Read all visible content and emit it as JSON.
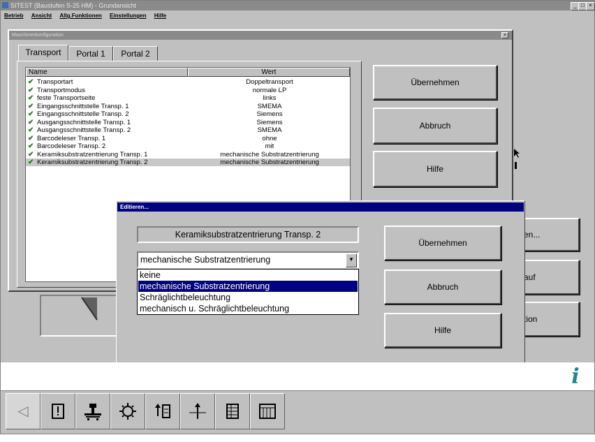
{
  "window": {
    "title": "SITEST (Baustufen S-25 HM) - Grundansicht",
    "menu": [
      "Betrieb",
      "Ansicht",
      "Allg.Funktionen",
      "Einstellungen",
      "Hilfe"
    ],
    "controls": [
      "_",
      "□",
      "×"
    ]
  },
  "machine_dialog": {
    "title": "Maschinenkonfiguration",
    "close": "×",
    "tabs": [
      "Transport",
      "Portal 1",
      "Portal 2"
    ],
    "columns": {
      "name": "Name",
      "value": "Wert"
    },
    "rows": [
      {
        "name": "Transportart",
        "value": "Doppeltransport"
      },
      {
        "name": "Transportmodus",
        "value": "normale LP"
      },
      {
        "name": "feste Transportseite",
        "value": "links"
      },
      {
        "name": "Eingangsschnittstelle Transp. 1",
        "value": "SMEMA"
      },
      {
        "name": "Eingangsschnittstelle Transp. 2",
        "value": "Siemens"
      },
      {
        "name": "Ausgangsschnittstelle Transp. 1",
        "value": "Siemens"
      },
      {
        "name": "Ausgangsschnittstelle Transp. 2",
        "value": "SMEMA"
      },
      {
        "name": "Barcodeleser Transp. 1",
        "value": "ohne"
      },
      {
        "name": "Barcodeleser Transp. 2",
        "value": "mit"
      },
      {
        "name": "Keramiksubstratzentrierung Transp. 1",
        "value": "mechanische Substratzentrierung"
      },
      {
        "name": "Keramiksubstratzentrierung Transp. 2",
        "value": "mechanische Substratzentrierung",
        "selected": true
      }
    ],
    "buttons": {
      "apply": "Übernehmen",
      "cancel": "Abbruch",
      "help": "Hilfe"
    }
  },
  "side_buttons": [
    "en...",
    "auf",
    "tion"
  ],
  "edit_dialog": {
    "title": "Editieren...",
    "field_label": "Keramiksubstratzentrierung Transp. 2",
    "combo_value": "mechanische Substratzentrierung",
    "options": [
      "keine",
      "mechanische Substratzentrierung",
      "Schräglichtbeleuchtung",
      "mechanisch u. Schräglichtbeleuchtung"
    ],
    "selected_option_index": 1,
    "buttons": {
      "apply": "Übernehmen",
      "cancel": "Abbruch",
      "help": "Hilfe"
    }
  },
  "toolbar_icons": [
    "back-arrow-icon",
    "alert-icon",
    "machine-icon",
    "gear-icon",
    "transfer-icon",
    "axis-icon",
    "list-icon",
    "grid-icon"
  ],
  "colors": {
    "titlebar_active": "#000080",
    "selection": "#000080",
    "check": "#1a7a1a",
    "info": "#1a8a8a"
  }
}
